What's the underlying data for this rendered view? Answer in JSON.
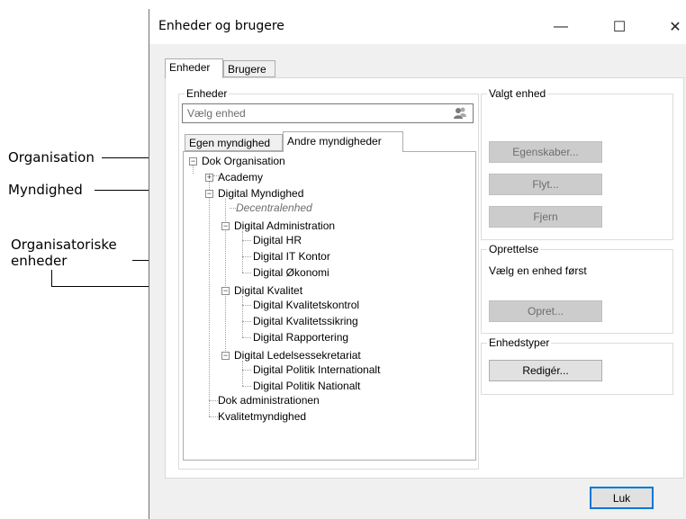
{
  "callouts": {
    "organisation": "Organisation",
    "myndighed": "Myndighed",
    "enheder_line1": "Organisatoriske",
    "enheder_line2": "enheder"
  },
  "window": {
    "title": "Enheder og brugere",
    "minimize": "—",
    "maximize": "☐",
    "close": "✕"
  },
  "main_tabs": [
    {
      "label": "Enheder",
      "active": true
    },
    {
      "label": "Brugere",
      "active": false
    }
  ],
  "enheder_group": {
    "label": "Enheder",
    "search_placeholder": "Vælg enhed",
    "search_icon": "users-icon"
  },
  "sub_tabs": [
    {
      "label": "Egen myndighed",
      "active": false
    },
    {
      "label": "Andre myndigheder",
      "active": true
    }
  ],
  "tree": [
    {
      "label": "Dok Organisation",
      "expander": "−"
    },
    {
      "label": "Academy",
      "expander": "+"
    },
    {
      "label": "Digital Myndighed",
      "expander": "−"
    },
    {
      "label": "Decentralenhed",
      "italic": true
    },
    {
      "label": "Digital Administration",
      "expander": "−"
    },
    {
      "label": "Digital HR"
    },
    {
      "label": "Digital IT Kontor"
    },
    {
      "label": "Digital Økonomi"
    },
    {
      "label": "Digital Kvalitet",
      "expander": "−"
    },
    {
      "label": "Digital Kvalitetskontrol"
    },
    {
      "label": "Digital Kvalitetssikring"
    },
    {
      "label": "Digital Rapportering"
    },
    {
      "label": "Digital Ledelsessekretariat",
      "expander": "−"
    },
    {
      "label": "Digital Politik Internationalt"
    },
    {
      "label": "Digital Politik Nationalt"
    },
    {
      "label": "Dok administrationen"
    },
    {
      "label": "Kvalitetmyndighed"
    }
  ],
  "valgt_enhed": {
    "label": "Valgt enhed",
    "egenskaber": "Egenskaber...",
    "flyt": "Flyt...",
    "fjern": "Fjern"
  },
  "oprettelse": {
    "label": "Oprettelse",
    "hint": "Vælg en enhed først",
    "opret": "Opret..."
  },
  "enhedstyper": {
    "label": "Enhedstyper",
    "rediger": "Redigér..."
  },
  "footer": {
    "luk": "Luk"
  }
}
